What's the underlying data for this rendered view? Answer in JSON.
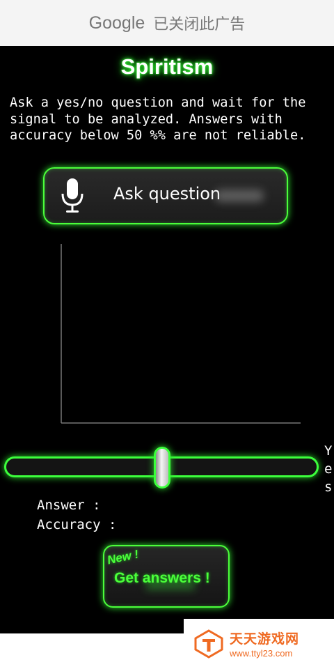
{
  "ad_banner": {
    "brand": "Google",
    "message": "已关闭此广告"
  },
  "app": {
    "title": "Spiritism",
    "instructions": [
      "Ask a yes/no question and wait for the",
      "signal to be analyzed. Answers with",
      "accuracy below 50 %% are not reliable."
    ],
    "ask_button": {
      "label": "Ask question",
      "icon": "microphone-icon"
    },
    "slider": {
      "value_fraction": 0.5,
      "side_label_letters": [
        "Y",
        "e",
        "s"
      ]
    },
    "result": {
      "answer_label": "Answer :",
      "accuracy_label": "Accuracy :"
    },
    "get_answers_button": {
      "badge": "New !",
      "label": "Get answers !"
    }
  },
  "colors": {
    "accent_glow": "#3cff3c",
    "background": "#000000",
    "text": "#ffffff"
  },
  "watermark": {
    "name": "天天游戏网",
    "url": "www.ttyl23.com"
  }
}
